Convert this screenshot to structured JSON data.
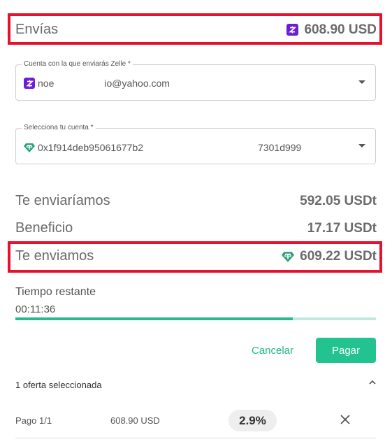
{
  "send": {
    "label": "Envías",
    "amount": "608.90 USD",
    "icon": "zelle-icon"
  },
  "zelle_account": {
    "label": "Cuenta con la que enviarás Zelle *",
    "value_prefix": "noe",
    "value_suffix": "io@yahoo.com",
    "icon": "zelle-icon"
  },
  "wallet_account": {
    "label": "Selecciona tu cuenta *",
    "value_prefix": "0x1f914deb95061677b2",
    "value_suffix": "7301d999",
    "icon": "tether-icon"
  },
  "summary": {
    "would_send_label": "Te enviaríamos",
    "would_send_value": "592.05 USDt",
    "benefit_label": "Beneficio",
    "benefit_value": "17.17 USDt",
    "we_send_label": "Te enviamos",
    "we_send_value": "609.22 USDt"
  },
  "timer": {
    "label": "Tiempo restante",
    "value": "00:11:36",
    "progress": 0.77
  },
  "actions": {
    "cancel": "Cancelar",
    "pay": "Pagar"
  },
  "offers": {
    "title": "1 oferta seleccionada",
    "payments": [
      {
        "step": "Pago 1/1",
        "amount": "608.90 USD",
        "percent": "2.9%"
      }
    ]
  },
  "colors": {
    "accent": "#22c38f",
    "highlight": "#e8112d",
    "zelle": "#6d1ed4",
    "tether": "#26a17b"
  }
}
